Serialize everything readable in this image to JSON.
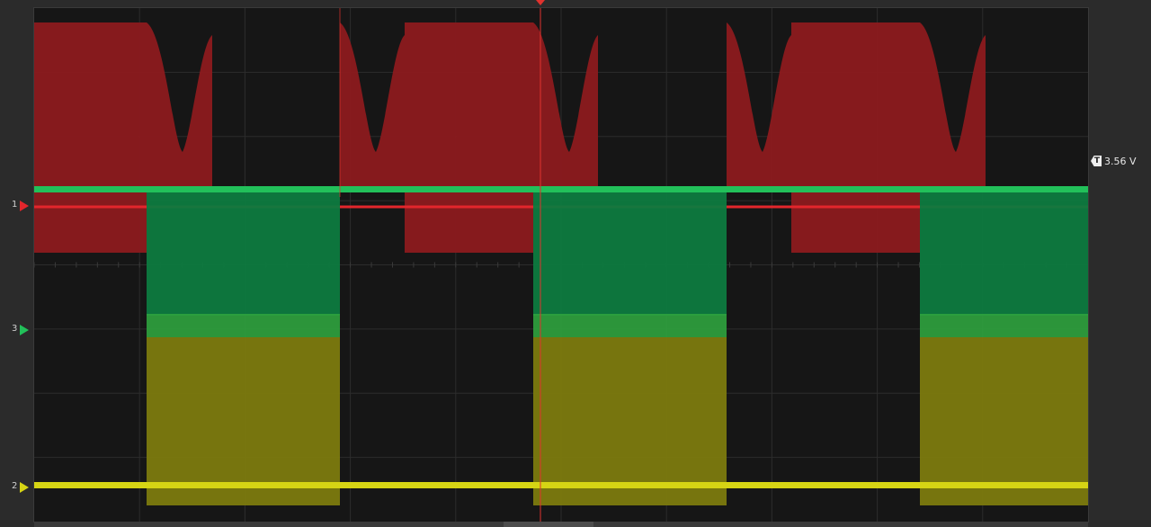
{
  "screen": {
    "background": "#161616",
    "grid_color": "#2c2c2c",
    "grid_divisions": {
      "horizontal": 10,
      "vertical": 8
    }
  },
  "channels": [
    {
      "number": "1",
      "color": "#e3262c",
      "fill": "#8c1a1d",
      "trace_type": "clock-with-ringing"
    },
    {
      "number": "3",
      "color": "#22c05a",
      "fill": "#0d7a3f",
      "trace_type": "square-wave"
    },
    {
      "number": "2",
      "color": "#d6d414",
      "fill": "#7c7a0e",
      "trace_type": "square-wave"
    }
  ],
  "trigger": {
    "level_label": "3.56 V",
    "icon_letter": "T",
    "color": "#e0322e"
  }
}
